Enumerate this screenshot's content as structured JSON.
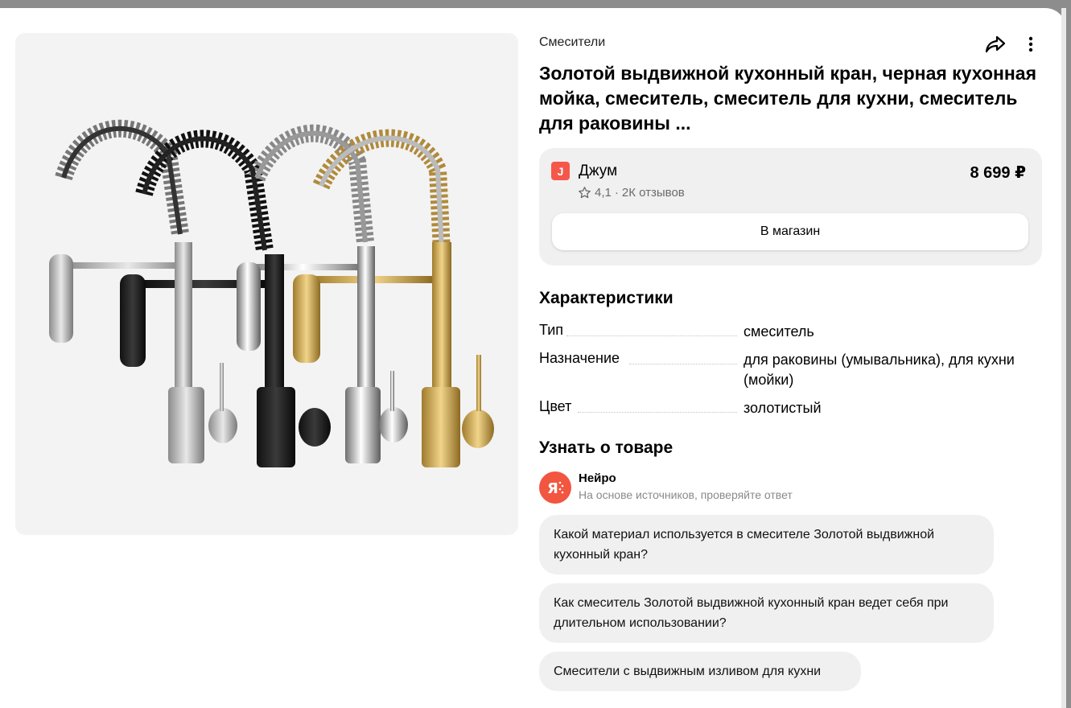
{
  "product": {
    "category": "Смесители",
    "title": "Золотой выдвижной кухонный кран, черная кухонная мойка, смеситель, смеситель для кухни, смеситель для раковины ..."
  },
  "shop": {
    "logo_letter": "J",
    "name": "Джум",
    "price": "8 699 ₽",
    "rating": "4,1",
    "reviews": "2К отзывов",
    "separator": "·",
    "button_label": "В магазин"
  },
  "specs": {
    "title": "Характеристики",
    "rows": [
      {
        "key": "Тип",
        "value": "смеситель"
      },
      {
        "key": "Назначение",
        "value": "для раковины (умывальника), для кухни (мойки)"
      },
      {
        "key": "Цвет",
        "value": "золотистый"
      }
    ]
  },
  "learn": {
    "title": "Узнать о товаре",
    "assistant_name": "Нейро",
    "assistant_note": "На основе источников, проверяйте ответ",
    "questions": [
      "Какой материал используется в смесителе Золотой выдвижной кухонный кран?",
      "Как смеситель Золотой выдвижной кухонный кран ведет себя при длительном использовании?",
      "Смесители с выдвижным изливом для кухни"
    ]
  },
  "icons": {
    "share": "share-arrow-icon",
    "more": "vertical-dots-icon",
    "star": "star-outline-icon",
    "assistant": "neuro-logo-icon"
  },
  "colors": {
    "shop_logo": "#f5574a",
    "assistant_logo": "#f25540",
    "card_background": "#f0f0f0"
  }
}
